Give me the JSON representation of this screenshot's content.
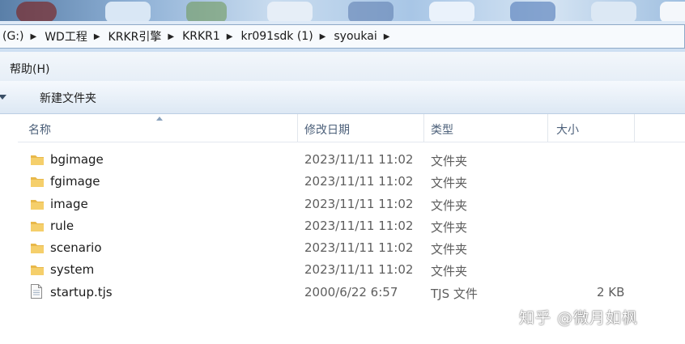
{
  "address": {
    "crumbs": [
      "(G:)",
      "WD工程",
      "KRKR引擎",
      "KRKR1",
      "kr091sdk (1)",
      "syoukai"
    ]
  },
  "menubar": {
    "help_label": "帮助(H)"
  },
  "toolbar": {
    "new_folder_label": "新建文件夹"
  },
  "columns": {
    "name": "名称",
    "modified": "修改日期",
    "type": "类型",
    "size": "大小"
  },
  "files": [
    {
      "name": "bgimage",
      "modified": "2023/11/11 11:02",
      "type": "文件夹",
      "size": "",
      "icon": "folder-icon"
    },
    {
      "name": "fgimage",
      "modified": "2023/11/11 11:02",
      "type": "文件夹",
      "size": "",
      "icon": "folder-icon"
    },
    {
      "name": "image",
      "modified": "2023/11/11 11:02",
      "type": "文件夹",
      "size": "",
      "icon": "folder-icon"
    },
    {
      "name": "rule",
      "modified": "2023/11/11 11:02",
      "type": "文件夹",
      "size": "",
      "icon": "folder-icon"
    },
    {
      "name": "scenario",
      "modified": "2023/11/11 11:02",
      "type": "文件夹",
      "size": "",
      "icon": "folder-icon"
    },
    {
      "name": "system",
      "modified": "2023/11/11 11:02",
      "type": "文件夹",
      "size": "",
      "icon": "folder-icon"
    },
    {
      "name": "startup.tjs",
      "modified": "2000/6/22 6:57",
      "type": "TJS 文件",
      "size": "2 KB",
      "icon": "file-icon"
    }
  ],
  "watermark": "知乎 @微月如枫",
  "colors": {
    "accent": "#cddff2",
    "folder": "#e8b84a",
    "header_text": "#4c607a"
  }
}
